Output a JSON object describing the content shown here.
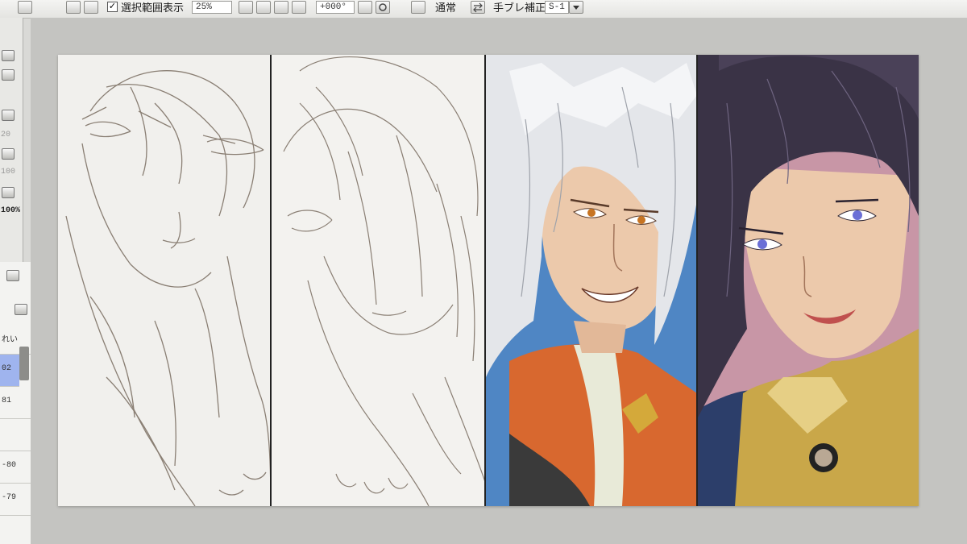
{
  "toolbar": {
    "selection_display_label": "選択範囲表示",
    "selection_display_checked": true,
    "zoom_value": "25%",
    "rotation_value": "+000°",
    "blend_mode": "通常",
    "stabilizer_label": "手ブレ補正",
    "stabilizer_value": "S-1"
  },
  "left_panel": {
    "values": [
      "20",
      "100",
      "100%"
    ]
  },
  "layers": {
    "labels": [
      "れい",
      "02",
      "81",
      "",
      "-80",
      "-79"
    ],
    "selected_index": 1
  },
  "canvas": {
    "panels": [
      {
        "name": "sketch-panel-1",
        "style": "pencil-sketch"
      },
      {
        "name": "sketch-panel-2",
        "style": "pencil-sketch"
      },
      {
        "name": "colored-panel-1",
        "style": "color-illustration"
      },
      {
        "name": "colored-panel-2",
        "style": "color-illustration"
      }
    ]
  },
  "colors": {
    "sketch_line": "#8a7f74",
    "silver_hair": "#e4e6ea",
    "dark_hair": "#3a3346",
    "skin": "#ecc9ab",
    "blue_bg": "#4f86c4",
    "pink_bg": "#c896a6",
    "orange_armor": "#d8682f",
    "gold_collar": "#c9a749",
    "blue_eye": "#6a6fd6",
    "amber_eye": "#c77422"
  }
}
